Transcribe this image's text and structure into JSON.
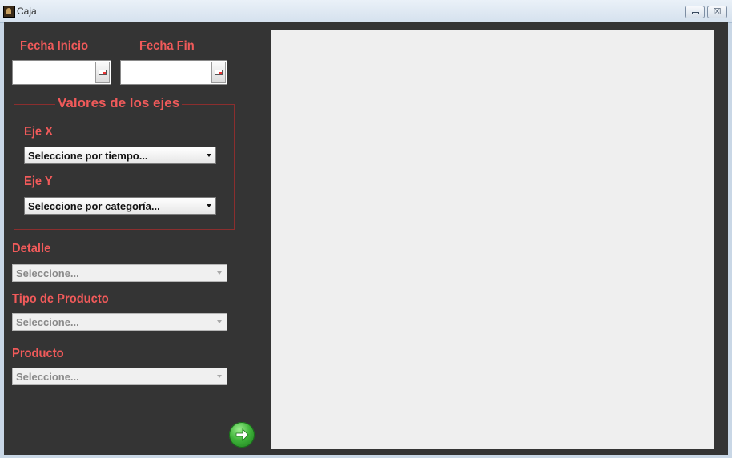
{
  "window": {
    "title": "Caja",
    "close_glyph": "☒"
  },
  "dates": {
    "start_label": "Fecha Inicio",
    "end_label": "Fecha Fin",
    "start_value": "",
    "end_value": ""
  },
  "axes": {
    "group_title": "Valores de los ejes",
    "x_label": "Eje X",
    "x_selected": "Seleccione por tiempo...",
    "y_label": "Eje Y",
    "y_selected": "Seleccione por categoría..."
  },
  "filters": {
    "detail_label": "Detalle",
    "detail_selected": "Seleccione...",
    "product_type_label": "Tipo de Producto",
    "product_type_selected": "Seleccione...",
    "product_label": "Producto",
    "product_selected": "Seleccione..."
  },
  "colors": {
    "label": "#f05a5a",
    "panel_bg": "#343434",
    "chart_bg": "#efefef",
    "go_button": "#3fb33a"
  },
  "icons": [
    "app-icon",
    "minimize-icon",
    "close-icon",
    "calendar-icon",
    "arrow-right-icon",
    "chevron-down-icon"
  ]
}
